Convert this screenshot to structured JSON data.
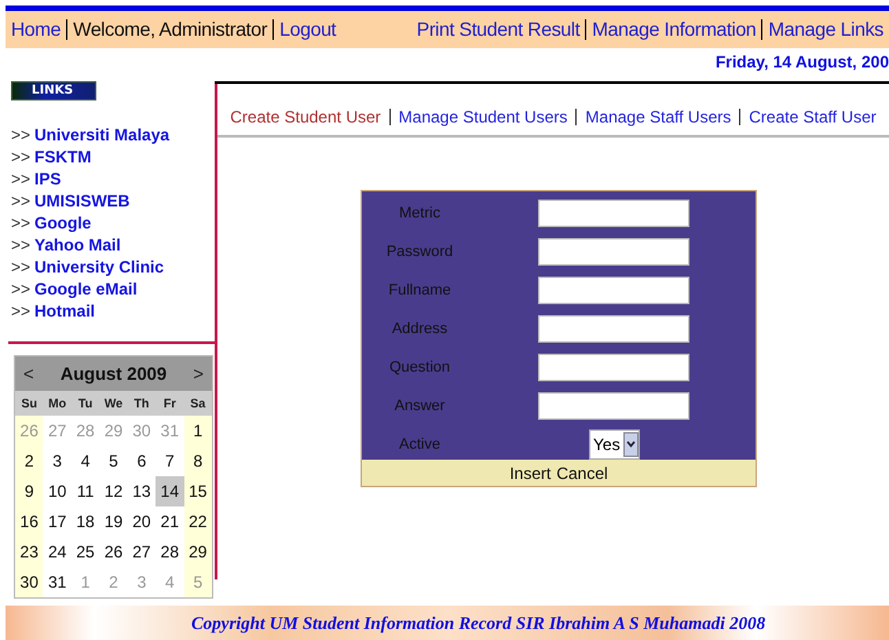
{
  "nav": {
    "left": [
      {
        "label": "Home",
        "kind": "link"
      },
      {
        "label": "Welcome, Administrator",
        "kind": "text"
      },
      {
        "label": "Logout",
        "kind": "link"
      }
    ],
    "right": [
      {
        "label": "Print Student Result"
      },
      {
        "label": "Manage Information"
      },
      {
        "label": "Manage Links"
      }
    ]
  },
  "date": "Friday, 14 August, 200",
  "sidebar": {
    "badge": "LINKS",
    "prefix": ">>",
    "links": [
      "Universiti Malaya",
      "FSKTM",
      "IPS",
      "UMISISWEB",
      "Google",
      "Yahoo Mail",
      "University Clinic",
      "Google eMail",
      "Hotmail"
    ]
  },
  "calendar": {
    "prev": "<",
    "title": "August 2009",
    "next": ">",
    "weekdays": [
      "Su",
      "Mo",
      "Tu",
      "We",
      "Th",
      "Fr",
      "Sa"
    ],
    "weeks": [
      [
        {
          "day": "26",
          "other": true,
          "selected": false
        },
        {
          "day": "27",
          "other": true,
          "selected": false
        },
        {
          "day": "28",
          "other": true,
          "selected": false
        },
        {
          "day": "29",
          "other": true,
          "selected": false
        },
        {
          "day": "30",
          "other": true,
          "selected": false
        },
        {
          "day": "31",
          "other": true,
          "selected": false
        },
        {
          "day": "1",
          "other": false,
          "selected": false
        }
      ],
      [
        {
          "day": "2",
          "other": false,
          "selected": false
        },
        {
          "day": "3",
          "other": false,
          "selected": false
        },
        {
          "day": "4",
          "other": false,
          "selected": false
        },
        {
          "day": "5",
          "other": false,
          "selected": false
        },
        {
          "day": "6",
          "other": false,
          "selected": false
        },
        {
          "day": "7",
          "other": false,
          "selected": false
        },
        {
          "day": "8",
          "other": false,
          "selected": false
        }
      ],
      [
        {
          "day": "9",
          "other": false,
          "selected": false
        },
        {
          "day": "10",
          "other": false,
          "selected": false
        },
        {
          "day": "11",
          "other": false,
          "selected": false
        },
        {
          "day": "12",
          "other": false,
          "selected": false
        },
        {
          "day": "13",
          "other": false,
          "selected": false
        },
        {
          "day": "14",
          "other": false,
          "selected": true
        },
        {
          "day": "15",
          "other": false,
          "selected": false
        }
      ],
      [
        {
          "day": "16",
          "other": false,
          "selected": false
        },
        {
          "day": "17",
          "other": false,
          "selected": false
        },
        {
          "day": "18",
          "other": false,
          "selected": false
        },
        {
          "day": "19",
          "other": false,
          "selected": false
        },
        {
          "day": "20",
          "other": false,
          "selected": false
        },
        {
          "day": "21",
          "other": false,
          "selected": false
        },
        {
          "day": "22",
          "other": false,
          "selected": false
        }
      ],
      [
        {
          "day": "23",
          "other": false,
          "selected": false
        },
        {
          "day": "24",
          "other": false,
          "selected": false
        },
        {
          "day": "25",
          "other": false,
          "selected": false
        },
        {
          "day": "26",
          "other": false,
          "selected": false
        },
        {
          "day": "27",
          "other": false,
          "selected": false
        },
        {
          "day": "28",
          "other": false,
          "selected": false
        },
        {
          "day": "29",
          "other": false,
          "selected": false
        }
      ],
      [
        {
          "day": "30",
          "other": false,
          "selected": false
        },
        {
          "day": "31",
          "other": false,
          "selected": false
        },
        {
          "day": "1",
          "other": true,
          "selected": false
        },
        {
          "day": "2",
          "other": true,
          "selected": false
        },
        {
          "day": "3",
          "other": true,
          "selected": false
        },
        {
          "day": "4",
          "other": true,
          "selected": false
        },
        {
          "day": "5",
          "other": true,
          "selected": false
        }
      ]
    ]
  },
  "tabs": [
    {
      "label": "Create Student User",
      "selected": true
    },
    {
      "label": "Manage Student Users",
      "selected": false
    },
    {
      "label": "Manage Staff Users",
      "selected": false
    },
    {
      "label": "Create Staff User",
      "selected": false
    }
  ],
  "form": {
    "fields": [
      {
        "label": "Metric",
        "kind": "text"
      },
      {
        "label": "Password",
        "kind": "text"
      },
      {
        "label": "Fullname",
        "kind": "text"
      },
      {
        "label": "Address",
        "kind": "text"
      },
      {
        "label": "Question",
        "kind": "text"
      },
      {
        "label": "Answer",
        "kind": "text"
      },
      {
        "label": "Active",
        "kind": "select",
        "value": "Yes"
      }
    ],
    "actions": [
      "Insert",
      "Cancel"
    ]
  },
  "footer": "Copyright UM Student Information Record  SIR  Ibrahim A S Muhamadi 2008"
}
